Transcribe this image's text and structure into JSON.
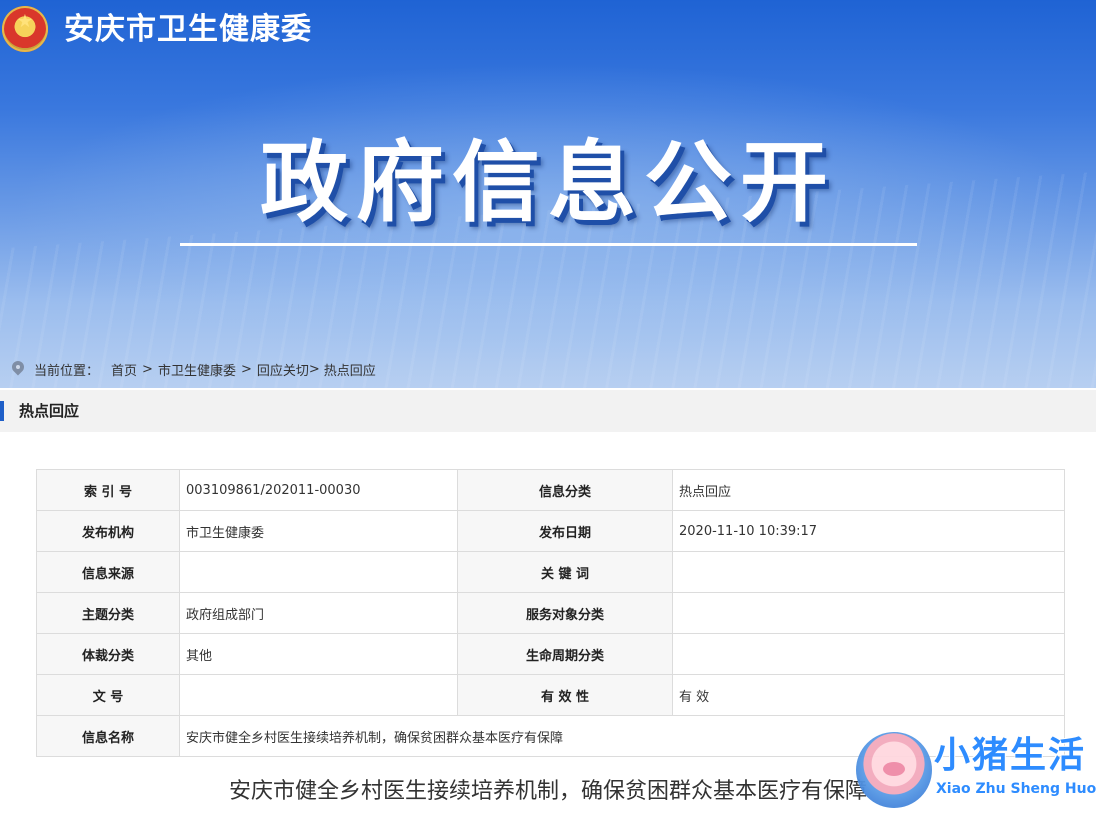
{
  "header": {
    "site_title": "安庆市卫生健康委",
    "hero_title": "政府信息公开"
  },
  "breadcrumb": {
    "label": "当前位置：",
    "items": [
      "首页",
      "市卫生健康委",
      "回应关切",
      "热点回应"
    ]
  },
  "section": {
    "title": "热点回应"
  },
  "info_table": {
    "rows": [
      [
        {
          "k": "索 引 号",
          "v": "003109861/202011-00030"
        },
        {
          "k": "信息分类",
          "v": "热点回应"
        }
      ],
      [
        {
          "k": "发布机构",
          "v": "市卫生健康委"
        },
        {
          "k": "发布日期",
          "v": "2020-11-10 10:39:17"
        }
      ],
      [
        {
          "k": "信息来源",
          "v": ""
        },
        {
          "k": "关 键 词",
          "v": ""
        }
      ],
      [
        {
          "k": "主题分类",
          "v": "政府组成部门"
        },
        {
          "k": "服务对象分类",
          "v": ""
        }
      ],
      [
        {
          "k": "体裁分类",
          "v": "其他"
        },
        {
          "k": "生命周期分类",
          "v": ""
        }
      ],
      [
        {
          "k": "文 号",
          "v": ""
        },
        {
          "k": "有 效 性",
          "v": "有 效"
        }
      ]
    ],
    "name_row": {
      "k": "信息名称",
      "v": "安庆市健全乡村医生接续培养机制，确保贫困群众基本医疗有保障"
    }
  },
  "article": {
    "title": "安庆市健全乡村医生接续培养机制，确保贫困群众基本医疗有保障"
  },
  "watermark": {
    "cn": "小猪生活",
    "en": "Xiao Zhu Sheng Huo"
  },
  "colors": {
    "banner_top": "#1f63d4",
    "accent_bar": "#1f5fc8",
    "watermark": "#2e8cff"
  }
}
